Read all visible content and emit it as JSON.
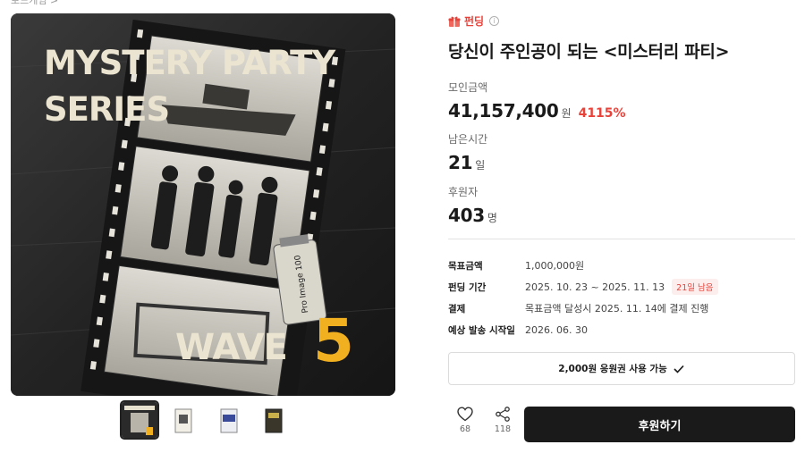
{
  "breadcrumb": "보드게임 >",
  "poster": {
    "title_line1": "MYSTERY PARTY",
    "title_line2": "SERIES",
    "wave_text": "WAVE",
    "wave_number": "5",
    "film_text": "Pro Image 100"
  },
  "thumbnails": [
    {
      "name": "main-cover"
    },
    {
      "name": "box-white"
    },
    {
      "name": "box-blue"
    },
    {
      "name": "box-dark"
    }
  ],
  "badge": {
    "label": "펀딩",
    "icon": "gift-icon"
  },
  "title": "당신이 주인공이 되는 <미스터리 파티>",
  "raised": {
    "label": "모인금액",
    "value": "41,157,400",
    "unit": "원",
    "percent": "4115%"
  },
  "remaining": {
    "label": "남은시간",
    "value": "21",
    "unit": "일"
  },
  "backers": {
    "label": "후원자",
    "value": "403",
    "unit": "명"
  },
  "details": [
    {
      "label": "목표금액",
      "value": "1,000,000원",
      "chip": ""
    },
    {
      "label": "펀딩 기간",
      "value": "2025. 10. 23 ~ 2025. 11. 13",
      "chip": "21일 남음"
    },
    {
      "label": "결제",
      "value": "목표금액 달성시 2025. 11. 14에 결제 진행",
      "chip": ""
    },
    {
      "label": "예상 발송 시작일",
      "value": "2026. 06. 30",
      "chip": ""
    }
  ],
  "coupon": {
    "label": "2,000원 응원권 사용 가능"
  },
  "likes": {
    "count": "68",
    "icon": "heart-icon"
  },
  "shares": {
    "count": "118",
    "icon": "share-icon"
  },
  "support_button": "후원하기",
  "colors": {
    "accent": "#e8433b",
    "button": "#1a1a1a",
    "wave_number": "#f0b020"
  }
}
